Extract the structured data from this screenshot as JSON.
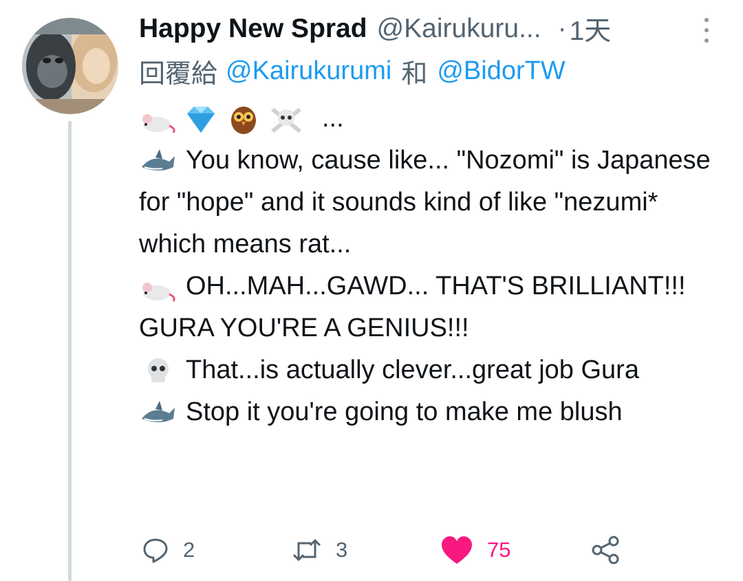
{
  "tweet": {
    "display_name": "Happy New Sprad",
    "handle": "@Kairukuru...",
    "separator": "·",
    "time": "1天",
    "reply_prefix": "回覆給",
    "reply_to": [
      "@Kairukurumi",
      "@BidorTW"
    ],
    "reply_joiner": "和",
    "body": {
      "intro_ellipsis": "...",
      "lines": [
        {
          "speaker_icon": "shark-emoji",
          "text": "You know, cause like... \"Nozomi\" is Japanese for \"hope\" and it sounds kind of like \"nezumi* which means rat..."
        },
        {
          "speaker_icon": "mouse-emoji",
          "text": "OH...MAH...GAWD... THAT'S BRILLIANT!!! GURA YOU'RE A GENIUS!!!"
        },
        {
          "speaker_icon": "skull-emoji",
          "text": "That...is actually clever...great job Gura"
        },
        {
          "speaker_icon": "shark-emoji",
          "text": "Stop it you're going to make me blush"
        }
      ]
    },
    "actions": {
      "replies": "2",
      "retweets": "3",
      "likes": "75"
    }
  },
  "colors": {
    "text": "#0f1419",
    "secondary": "#536471",
    "link": "#1d9bf0",
    "like": "#f91880",
    "thread_line": "#cfd9de"
  },
  "icons": [
    "avatar-gorilla",
    "more-icon",
    "mouse-emoji",
    "gem-emoji",
    "owl-emoji",
    "skull-crossbones-emoji",
    "shark-emoji",
    "skull-emoji",
    "reply-icon",
    "retweet-icon",
    "heart-icon",
    "share-icon"
  ]
}
